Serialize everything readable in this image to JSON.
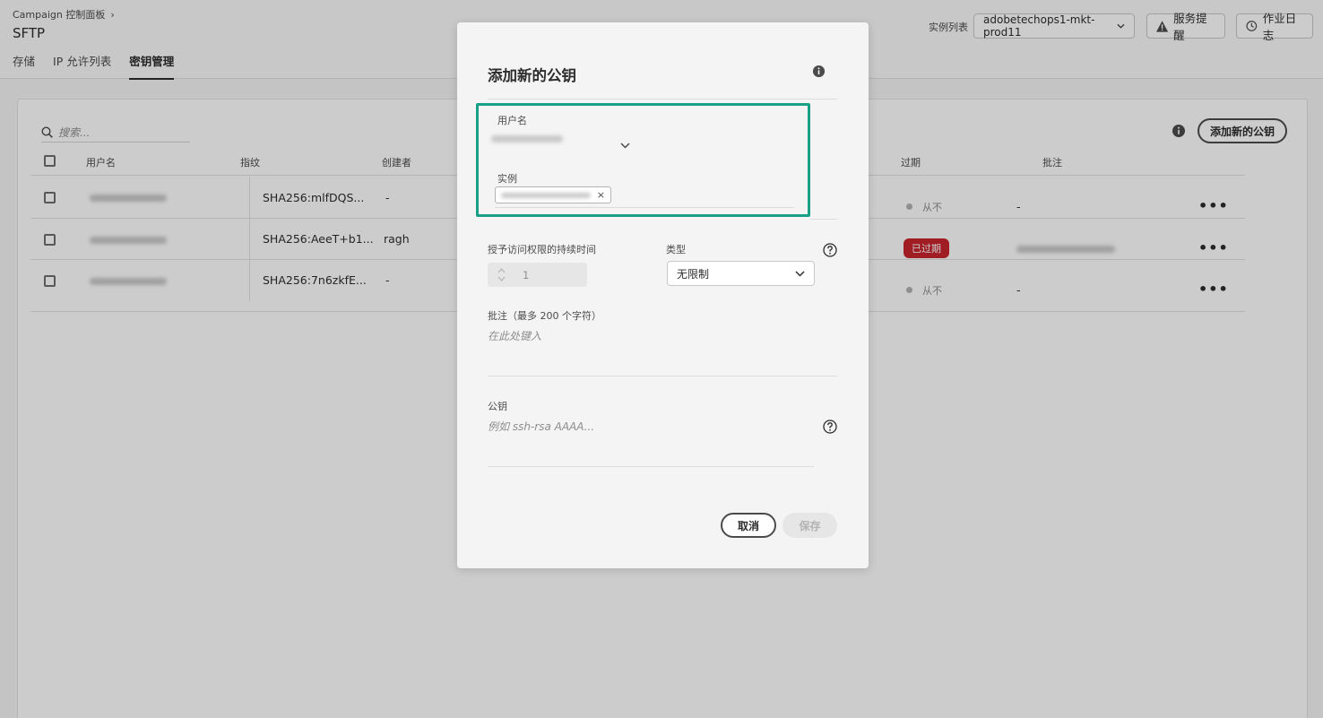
{
  "header": {
    "breadcrumb": "Campaign 控制面板",
    "breadcrumb_sep": "›",
    "title": "SFTP",
    "tabs": [
      {
        "label": "存储"
      },
      {
        "label": "IP 允许列表"
      },
      {
        "label": "密钥管理",
        "active": true
      }
    ],
    "instance_label": "实例列表",
    "instance_value": "adobetechops1-mkt-prod11",
    "alerts_label": "服务提醒",
    "log_label": "作业日志"
  },
  "panel": {
    "search_placeholder": "搜索...",
    "add_key_label": "添加新的公钥",
    "columns": [
      "用户名",
      "指纹",
      "创建者",
      "过期",
      "批注"
    ],
    "rows": [
      {
        "fingerprint": "SHA256:mlfDQS...",
        "creator": "-",
        "expiry": "从不",
        "note": "-"
      },
      {
        "fingerprint": "SHA256:AeeT+b1...",
        "creator": "ragh",
        "expiry": "已过期",
        "note": ""
      },
      {
        "fingerprint": "SHA256:7n6zkfE...",
        "creator": "-",
        "expiry": "从不",
        "note": "-"
      }
    ]
  },
  "modal": {
    "title": "添加新的公钥",
    "username_label": "用户名",
    "instance_label": "实例",
    "duration_label": "授予访问权限的持续时间",
    "duration_value": "1",
    "type_label": "类型",
    "type_value": "无限制",
    "comment_label": "批注（最多 200 个字符）",
    "comment_placeholder": "在此处键入",
    "key_label": "公钥",
    "key_placeholder": "例如 ssh-rsa AAAA...",
    "cancel_label": "取消",
    "save_label": "保存",
    "tag_remove": "×"
  },
  "colors": {
    "highlight": "#1aa086",
    "expired_badge": "#c9252d"
  },
  "icons": [
    "search-icon",
    "chevron-down-icon",
    "alert-icon",
    "history-icon",
    "info-icon",
    "help-icon",
    "more-icon",
    "close-icon"
  ]
}
